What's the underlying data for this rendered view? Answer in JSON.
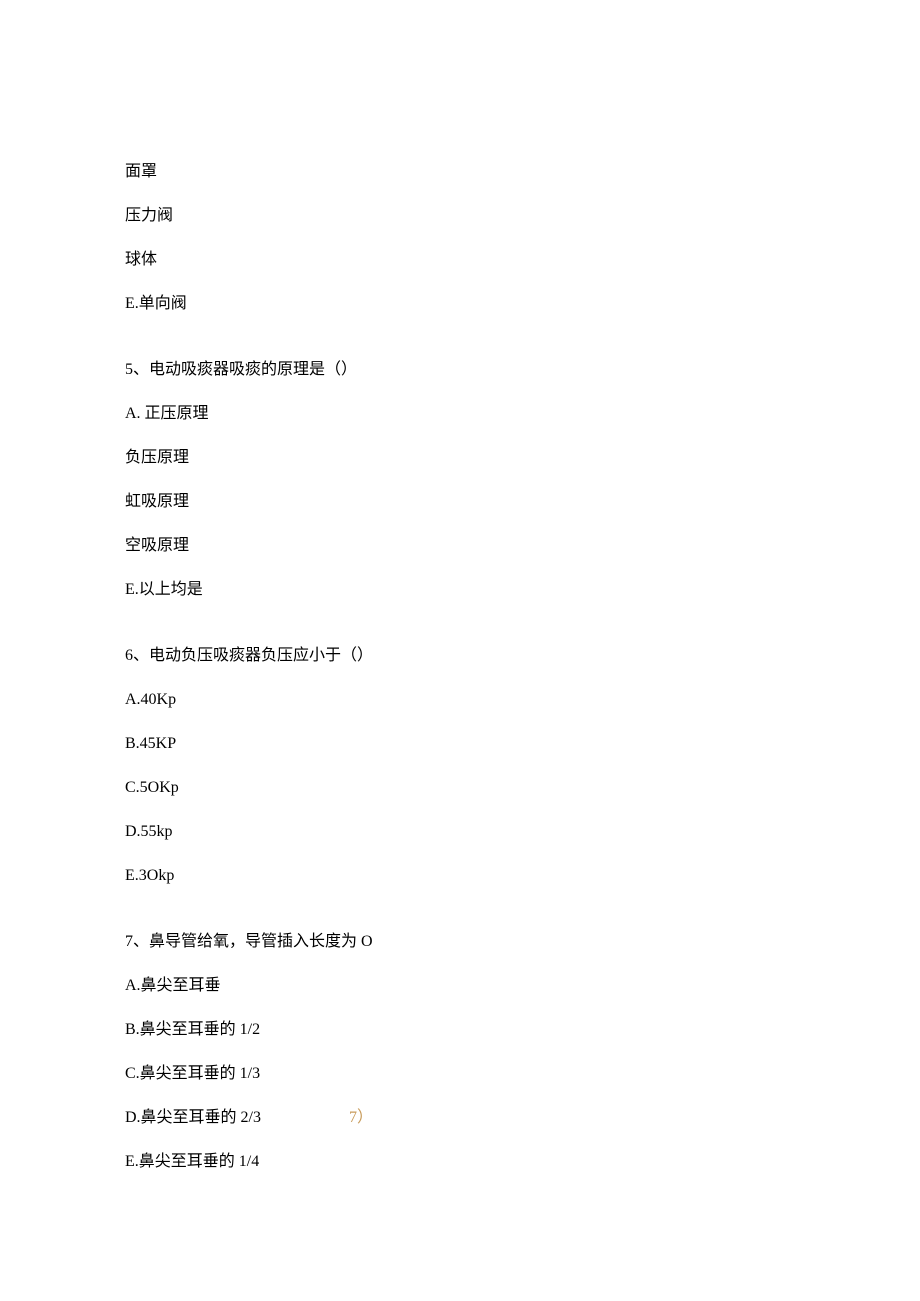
{
  "intro_lines": [
    "面罩",
    "压力阀",
    "球体",
    "E.单向阀"
  ],
  "questions": [
    {
      "stem": "5、电动吸痰器吸痰的原理是（）",
      "options": [
        "A. 正压原理",
        "负压原理",
        "虹吸原理",
        "空吸原理",
        "E.以上均是"
      ]
    },
    {
      "stem": "6、电动负压吸痰器负压应小于（）",
      "options": [
        "A.40Kp",
        "B.45KP",
        "C.5OKp",
        "D.55kp",
        "E.3Okp"
      ]
    },
    {
      "stem": "7、鼻导管给氧，导管插入长度为 O",
      "options": [
        "A.鼻尖至耳垂",
        "B.鼻尖至耳垂的 1/2",
        "C.鼻尖至耳垂的 1/3",
        "D.鼻尖至耳垂的 2/3",
        "E.鼻尖至耳垂的 1/4"
      ],
      "annotation_on_d": "7）"
    }
  ]
}
